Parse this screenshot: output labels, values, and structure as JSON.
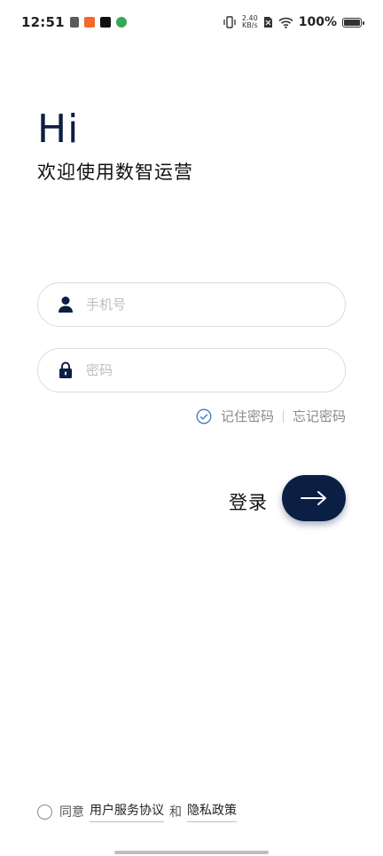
{
  "status_bar": {
    "time": "12:51",
    "net_speed_value": "2.40",
    "net_speed_unit": "KB/s",
    "battery_percent": "100%",
    "battery_level": 1.0
  },
  "greeting": {
    "hi": "Hi",
    "subtitle": "欢迎使用数智运营"
  },
  "form": {
    "phone_placeholder": "手机号",
    "password_placeholder": "密码",
    "remember_label": "记住密码",
    "forget_label": "忘记密码",
    "remember_checked": true
  },
  "login": {
    "label": "登录"
  },
  "agreement": {
    "agree_text": "同意",
    "service_link": "用户服务协议",
    "and_text": "和",
    "privacy_link": "隐私政策",
    "checked": false
  },
  "colors": {
    "primary": "#0b1f44",
    "check_icon": "#3a7bbf"
  }
}
